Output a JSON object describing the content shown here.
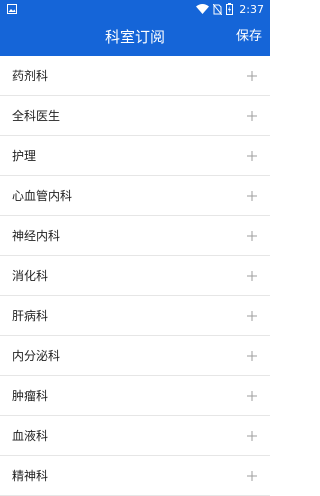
{
  "status_bar": {
    "time": "2:37",
    "icons": [
      "image-icon",
      "wifi-icon",
      "no-sim-icon",
      "battery-charging-icon"
    ]
  },
  "app_bar": {
    "title": "科室订阅",
    "save_label": "保存"
  },
  "colors": {
    "primary": "#1565d8",
    "divider": "#e6e6e6",
    "plus": "#9e9e9e"
  },
  "departments": [
    {
      "label": "药剂科"
    },
    {
      "label": "全科医生"
    },
    {
      "label": "护理"
    },
    {
      "label": "心血管内科"
    },
    {
      "label": "神经内科"
    },
    {
      "label": "消化科"
    },
    {
      "label": "肝病科"
    },
    {
      "label": "内分泌科"
    },
    {
      "label": "肿瘤科"
    },
    {
      "label": "血液科"
    },
    {
      "label": "精神科"
    }
  ]
}
